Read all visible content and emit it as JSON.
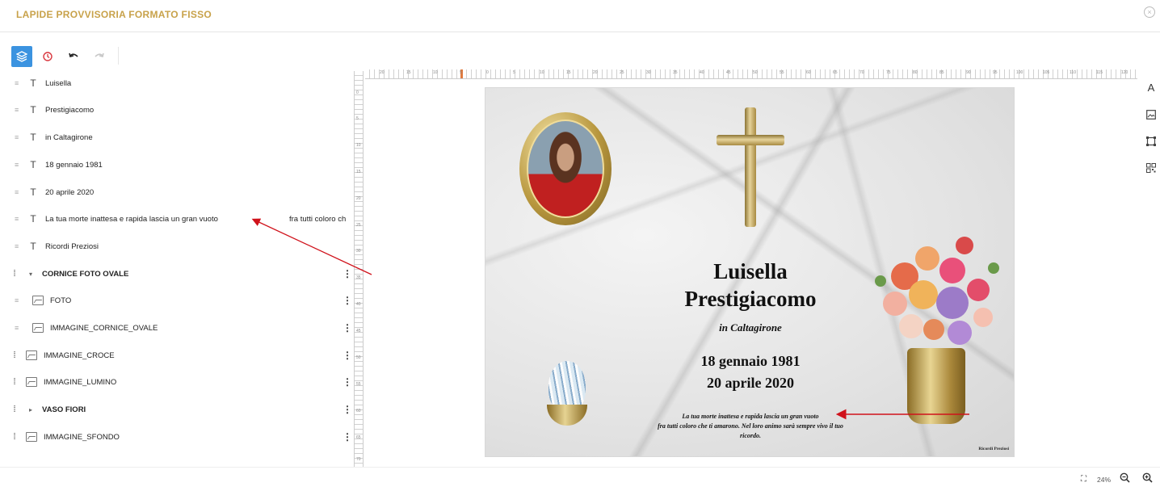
{
  "header": {
    "title": "LAPIDE PROVVISORIA FORMATO FISSO"
  },
  "toolbar": {
    "layers_icon": "layers-icon",
    "history_icon": "history-icon",
    "undo_icon": "undo-icon",
    "redo_icon": "redo-icon"
  },
  "layers": [
    {
      "label": "Luisella",
      "type": "text"
    },
    {
      "label": "Prestigiacomo",
      "type": "text"
    },
    {
      "label": "in Caltagirone",
      "type": "text"
    },
    {
      "label": "18 gennaio 1981",
      "type": "text"
    },
    {
      "label": "20 aprile 2020",
      "type": "text"
    },
    {
      "label": "La tua morte inattesa e rapida lascia un gran vuoto",
      "extra": "fra tutti coloro ch",
      "type": "text"
    },
    {
      "label": "Ricordi Preziosi",
      "type": "text"
    },
    {
      "label": "CORNICE FOTO  OVALE",
      "type": "group",
      "expanded": true
    },
    {
      "label": "FOTO",
      "type": "image",
      "nested": true
    },
    {
      "label": "IMMAGINE_CORNICE_OVALE",
      "type": "image",
      "nested": true
    },
    {
      "label": "IMMAGINE_CROCE",
      "type": "image"
    },
    {
      "label": "IMMAGINE_LUMINO",
      "type": "image"
    },
    {
      "label": "VASO FIORI",
      "type": "group",
      "expanded": false
    },
    {
      "label": "IMMAGINE_SFONDO",
      "type": "image"
    }
  ],
  "ruler": {
    "horizontal": [
      "20",
      "15",
      "10",
      "5",
      "0",
      "5",
      "10",
      "15",
      "20",
      "25",
      "30",
      "35",
      "40",
      "45",
      "50",
      "55",
      "60",
      "65",
      "70",
      "75",
      "80",
      "85",
      "90",
      "95",
      "100",
      "105",
      "110",
      "115",
      "120"
    ],
    "vertical": [
      "0",
      "5",
      "10",
      "15",
      "20",
      "25",
      "30",
      "35",
      "40",
      "45",
      "50",
      "55",
      "60",
      "65",
      "70"
    ]
  },
  "canvas": {
    "name1": "Luisella",
    "name2": "Prestigiacomo",
    "place": "in Caltagirone",
    "date1": "18 gennaio 1981",
    "date2": "20 aprile 2020",
    "epitaph_line1": "La tua morte inattesa e rapida lascia un gran vuoto",
    "epitaph_line2": "fra tutti coloro che ti amarono. Nel loro animo sarà sempre vivo il tuo",
    "epitaph_line3": "ricordo.",
    "signature": "Ricordi Preziosi"
  },
  "side_tools": [
    "text-tool-icon",
    "image-tool-icon",
    "shape-tool-icon",
    "qr-tool-icon"
  ],
  "side_text_label": "A",
  "footer": {
    "zoom": "24%"
  },
  "colors": {
    "accent": "#3b93e0",
    "title": "#c8a24a",
    "arrow": "#d0121b"
  }
}
